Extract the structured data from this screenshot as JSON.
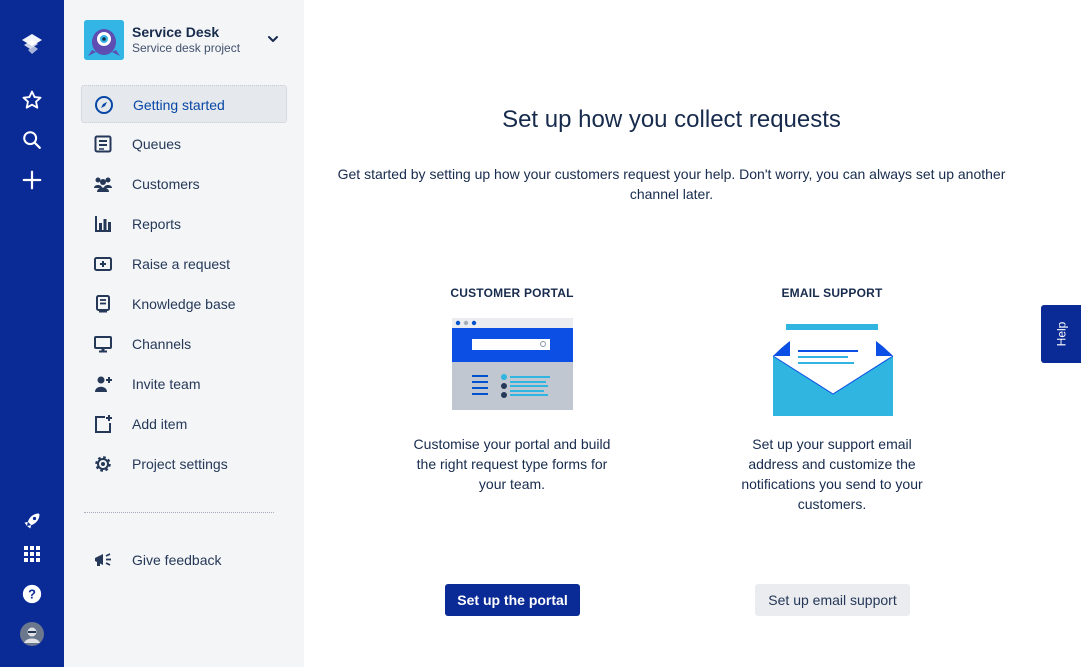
{
  "global_nav": {
    "icons": [
      "app-logo-icon",
      "star-icon",
      "search-icon",
      "plus-icon",
      "rocket-icon",
      "app-switcher-icon",
      "help-icon",
      "user-avatar-icon"
    ]
  },
  "project": {
    "name": "Service Desk",
    "type": "Service desk project"
  },
  "sidebar": {
    "items": [
      {
        "label": "Getting started",
        "icon": "compass-icon",
        "active": true
      },
      {
        "label": "Queues",
        "icon": "queue-icon"
      },
      {
        "label": "Customers",
        "icon": "people-icon"
      },
      {
        "label": "Reports",
        "icon": "chart-icon"
      },
      {
        "label": "Raise a request",
        "icon": "add-request-icon"
      },
      {
        "label": "Knowledge base",
        "icon": "book-icon"
      },
      {
        "label": "Channels",
        "icon": "monitor-icon"
      },
      {
        "label": "Invite team",
        "icon": "invite-icon"
      },
      {
        "label": "Add item",
        "icon": "add-item-icon"
      },
      {
        "label": "Project settings",
        "icon": "gear-icon"
      }
    ],
    "feedback": {
      "label": "Give feedback",
      "icon": "megaphone-icon"
    }
  },
  "main": {
    "title": "Set up how you collect requests",
    "subtitle": "Get started by setting up how your customers request your help. Don't worry, you can always set up another channel later.",
    "cards": [
      {
        "title": "CUSTOMER PORTAL",
        "description": "Customise your portal and build the right request type forms for your team.",
        "button": "Set up the portal"
      },
      {
        "title": "EMAIL SUPPORT",
        "description": "Set up your support email address and customize the notifications you send to your customers.",
        "button": "Set up email support"
      }
    ]
  },
  "help_tab": "Help",
  "colors": {
    "global_nav_bg": "#0A2A96",
    "sidebar_bg": "#F4F5F7",
    "primary_button": "#0A2A96",
    "active_text": "#0747A6",
    "illustration_blue": "#0052CC",
    "illustration_cyan": "#2FB5DF"
  }
}
